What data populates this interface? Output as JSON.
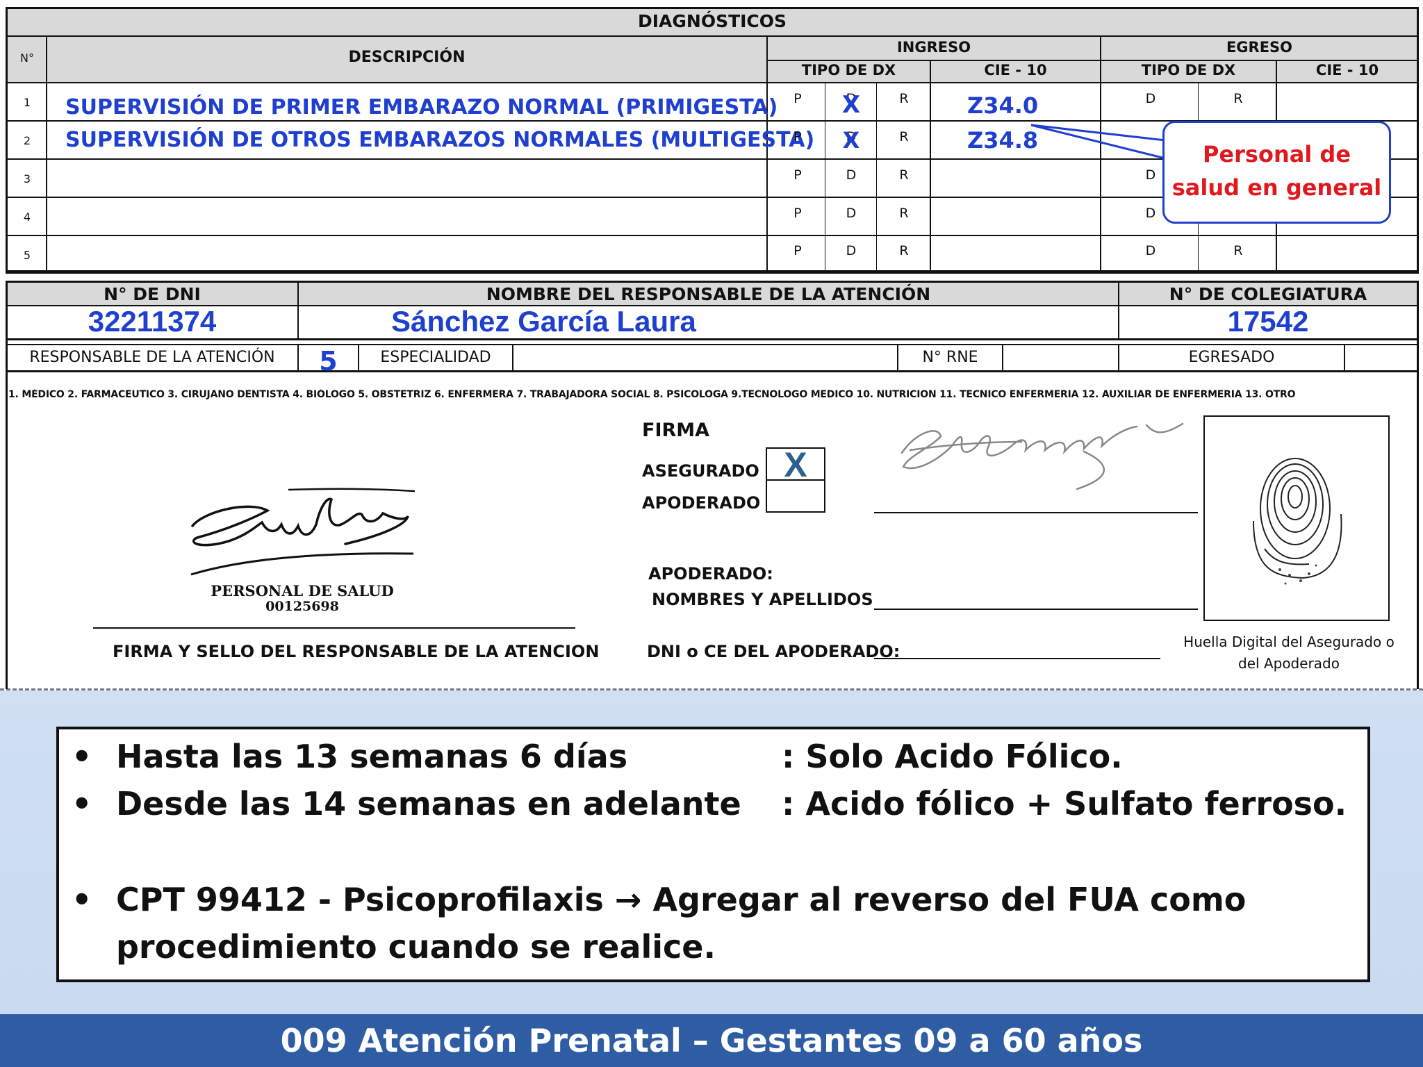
{
  "diagnosticos": {
    "title": "DIAGNÓSTICOS",
    "col_n": "N°",
    "col_descripcion": "DESCRIPCIÓN",
    "ingreso": "INGRESO",
    "egreso": "EGRESO",
    "tipo_dx": "TIPO DE DX",
    "cie": "CIE - 10",
    "rows": [
      {
        "n": "1",
        "desc": "SUPERVISIÓN DE PRIMER EMBARAZO NORMAL  (PRIMIGESTA)",
        "cie": "Z34.0"
      },
      {
        "n": "2",
        "desc": "SUPERVISIÓN DE OTROS EMBARAZOS NORMALES (MULTIGESTA)",
        "cie": "Z34.8"
      },
      {
        "n": "3",
        "desc": "",
        "cie": ""
      },
      {
        "n": "4",
        "desc": "",
        "cie": ""
      },
      {
        "n": "5",
        "desc": "",
        "cie": ""
      }
    ],
    "p": "P",
    "d": "D",
    "r": "R",
    "mark": "X"
  },
  "callout": {
    "line1": "Personal de",
    "line2": "salud en general"
  },
  "responsable": {
    "dni_label": "N° DE DNI",
    "dni_value": "32211374",
    "nombre_label": "NOMBRE DEL RESPONSABLE DE LA ATENCIÓN",
    "nombre_value": "Sánchez García Laura",
    "colegiatura_label": "N° DE COLEGIATURA",
    "colegiatura_value": "17542",
    "resp_label": "RESPONSABLE DE LA ATENCIÓN",
    "resp_value": "5",
    "especialidad_label": "ESPECIALIDAD",
    "rne_label": "N° RNE",
    "egresado_label": "EGRESADO",
    "legend": "1. MÉDICO  2. FARMACEUTICO  3. CIRUJANO DENTISTA  4. BIÓLOGO  5. OBSTETRIZ  6. ENFERMERA  7. TRABAJADORA SOCIAL  8. PSICOLOGA  9.TECNOLOGO MEDICO  10. NUTRICION  11. TECNICO ENFERMERIA  12. AUXILIAR DE ENFERMERIA  13. OTRO"
  },
  "firma": {
    "firma_label": "FIRMA",
    "asegurado_label": "ASEGURADO",
    "apoderado_label": "APODERADO",
    "asegurado_mark": "X",
    "stamp_line1": "PERSONAL DE SALUD",
    "stamp_line2": "00125698",
    "sello_label": "FIRMA Y SELLO DEL RESPONSABLE DE LA ATENCION",
    "apoderado_title": "APODERADO:",
    "nombres_label": "NOMBRES Y APELLIDOS",
    "dni_apoderado_label": "DNI  o CE DEL APODERADO:",
    "huella_line1": "Huella Digital del Asegurado o",
    "huella_line2": "del Apoderado"
  },
  "notes": {
    "n1_left": "Hasta las 13 semanas 6 días",
    "n1_right": ":  Solo Acido Fólico.",
    "n2_left": "Desde las 14 semanas en adelante",
    "n2_right": ":  Acido fólico + Sulfato ferroso.",
    "n3_line1": "CPT 99412 - Psicoprofilaxis  → Agregar al reverso del FUA como",
    "n3_line2": "procedimiento cuando se realice.",
    "bullet": "•"
  },
  "footer": {
    "title": "009 Atención Prenatal – Gestantes  09 a 60 años"
  },
  "colors": {
    "blue_text": "#1f3fcf",
    "callout_red": "#e0191f",
    "footer_bg": "#2e5da4"
  }
}
